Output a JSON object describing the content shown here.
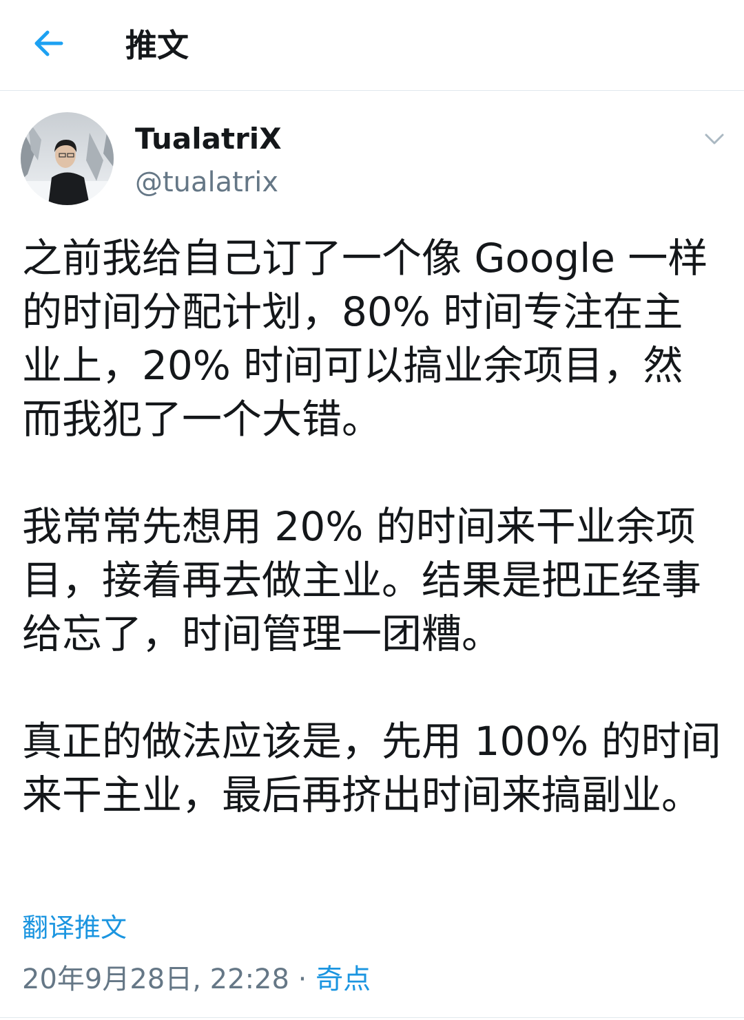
{
  "header": {
    "title": "推文",
    "back_icon": "arrow-left-icon",
    "accent_color": "#1da1f2"
  },
  "author": {
    "name": "TualatriX",
    "handle": "@tualatrix",
    "avatar": "avatar-photo",
    "menu_icon": "chevron-down-icon"
  },
  "tweet": {
    "paragraphs": [
      "之前我给自己订了一个像 Google 一样的时间分配计划，80% 时间专注在主业上，20% 时间可以搞业余项目，然而我犯了一个大错。",
      "我常常先想用 20% 的时间来干业余项目，接着再去做主业。结果是把正经事给忘了，时间管理一团糟。",
      "真正的做法应该是，先用 100% 的时间来干主业，最后再挤出时间来搞副业。"
    ],
    "translate_label": "翻译推文",
    "timestamp": "20年9月28日, 22:28",
    "separator": " · ",
    "source": "奇点"
  },
  "colors": {
    "text": "#14171a",
    "secondary": "#657786",
    "link": "#1b95e0"
  }
}
